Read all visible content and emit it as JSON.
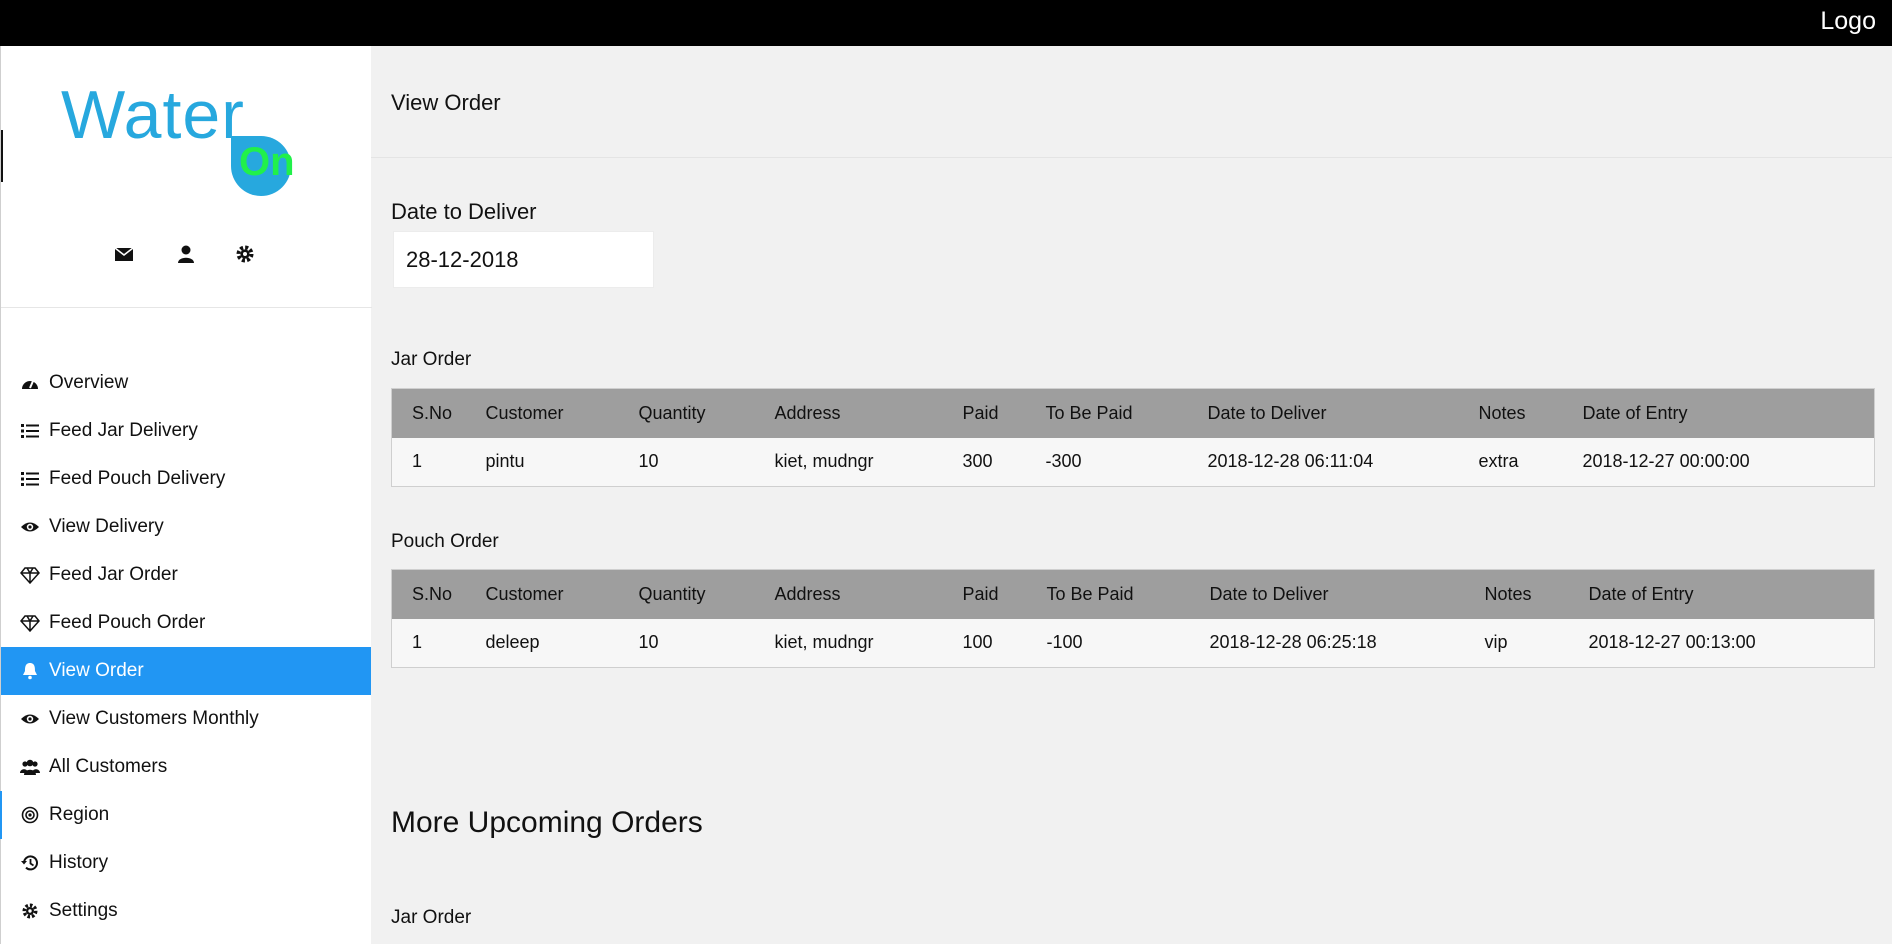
{
  "topbar": {
    "logo": "Logo"
  },
  "brand": {
    "word": "Water",
    "badge": "On"
  },
  "sidebar": {
    "icons": [
      "envelope-icon",
      "user-icon",
      "gear-icon"
    ],
    "items": [
      {
        "label": "Overview",
        "icon": "dashboard-icon"
      },
      {
        "label": "Feed Jar Delivery",
        "icon": "list-icon"
      },
      {
        "label": "Feed Pouch Delivery",
        "icon": "list-icon"
      },
      {
        "label": "View Delivery",
        "icon": "eye-icon"
      },
      {
        "label": "Feed Jar Order",
        "icon": "diamond-icon"
      },
      {
        "label": "Feed Pouch Order",
        "icon": "diamond-icon"
      },
      {
        "label": "View Order",
        "icon": "bell-icon",
        "active": true
      },
      {
        "label": "View Customers Monthly",
        "icon": "eye-icon"
      },
      {
        "label": "All Customers",
        "icon": "users-icon"
      },
      {
        "label": "Region",
        "icon": "target-icon"
      },
      {
        "label": "History",
        "icon": "history-icon"
      },
      {
        "label": "Settings",
        "icon": "gear-icon"
      }
    ],
    "accent": "#2196f3"
  },
  "main": {
    "title": "View Order",
    "date_label": "Date to Deliver",
    "date_value": "28-12-2018",
    "jar": {
      "title": "Jar Order",
      "headers": [
        "S.No",
        "Customer",
        "Quantity",
        "Address",
        "Paid",
        "To Be Paid",
        "Date to Deliver",
        "Notes",
        "Date of Entry"
      ],
      "rows": [
        [
          "1",
          "pintu",
          "10",
          "kiet, mudngr",
          "300",
          "-300",
          "2018-12-28 06:11:04",
          "extra",
          "2018-12-27 00:00:00"
        ]
      ]
    },
    "pouch": {
      "title": "Pouch Order",
      "headers": [
        "S.No",
        "Customer",
        "Quantity",
        "Address",
        "Paid",
        "To Be Paid",
        "Date to Deliver",
        "Notes",
        "Date of Entry"
      ],
      "rows": [
        [
          "1",
          "deleep",
          "10",
          "kiet, mudngr",
          "100",
          "-100",
          "2018-12-28 06:25:18",
          "vip",
          "2018-12-27 00:13:00"
        ]
      ]
    },
    "more_title": "More Upcoming Orders",
    "more_jar_title": "Jar Order"
  }
}
